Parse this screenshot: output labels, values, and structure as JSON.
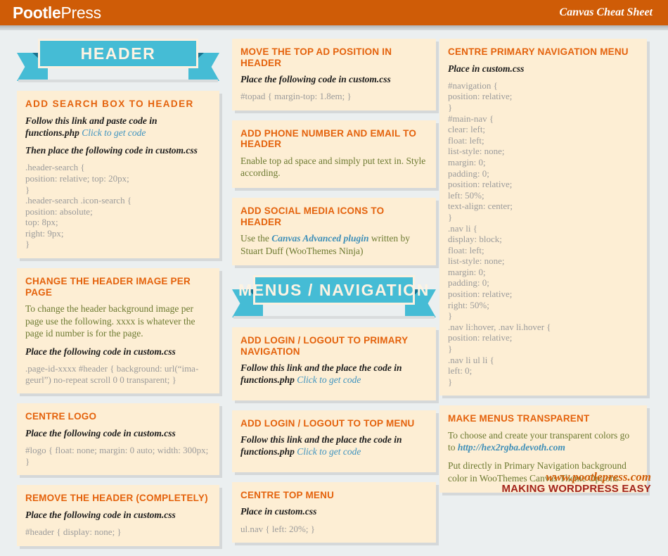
{
  "topbar": {
    "logo_bold": "Pootle",
    "logo_regular": "Press",
    "sheet_title": "Canvas Cheat Sheet",
    "background_color": "#cf5c07"
  },
  "colors": {
    "page_background": "#ebeff0",
    "card_background": "#fdeed4",
    "card_shadow": "#d5d8d9",
    "accent_orange": "#e4620c",
    "ribbon_teal": "#45bcd5",
    "ribbon_fold": "#17728f",
    "ribbon_border": "#fbf0e0",
    "code_grey": "#9b9b9b",
    "body_olive": "#6d7a31",
    "link_blue": "#3e93bf",
    "footer_url": "#cf5c07",
    "footer_tag": "#a3231a"
  },
  "banners": {
    "header": "HEADER",
    "menus": "MENUS / NAVIGATION"
  },
  "left_column": [
    {
      "title": "ADD  SEARCH BOX  TO HEADER",
      "lead": "Follow this link and paste code in functions.php ",
      "lead_link": "Click to get code",
      "lead2": "Then place the following code in custom.css",
      "code": ".header-search {\nposition: relative; top: 20px;\n}\n.header-search .icon-search {\nposition: absolute;\ntop: 8px;\nright: 9px;\n}"
    },
    {
      "title": "CHANGE THE HEADER IMAGE PER PAGE",
      "body": "To change the header background image per page use the following. xxxx is whatever the page id number is for the page.",
      "lead2": "Place the following code in custom.css",
      "code": ".page-id-xxxx #header { background: url(“ima-geurl”) no-repeat scroll 0 0 transparent; }"
    },
    {
      "title": "CENTRE LOGO",
      "lead2": "Place the following code in custom.css",
      "code": "#logo { float: none; margin: 0 auto; width: 300px; }"
    },
    {
      "title": "REMOVE THE HEADER (COMPLETELY)",
      "lead2": "Place the following code in custom.css",
      "code": "#header { display: none; }"
    }
  ],
  "mid_column_top": [
    {
      "title": "MOVE THE TOP AD POSITION IN HEADER",
      "lead2": "Place the following code in custom.css",
      "code": "#topad { margin-top: 1.8em; }"
    },
    {
      "title": "ADD PHONE NUMBER AND EMAIL TO HEADER",
      "body": "Enable top ad space and simply put text in. Style according."
    },
    {
      "title": "ADD SOCIAL MEDIA ICONS TO HEADER",
      "body_prefix": "Use the ",
      "body_emph": "Canvas Advanced plugin",
      "body_suffix": " written by Stuart Duff (WooThemes Ninja)"
    }
  ],
  "mid_column_bottom": [
    {
      "title": "ADD LOGIN / LOGOUT TO PRIMARY NAVIGATION",
      "lead": "Follow this link and the place the code in functions.php ",
      "lead_link": "Click to get code"
    },
    {
      "title": "ADD LOGIN / LOGOUT TO TOP MENU",
      "lead": "Follow this link and the place the code in functions.php ",
      "lead_link": "Click to get code"
    },
    {
      "title": "CENTRE TOP MENU",
      "lead2": "Place in custom.css",
      "code": "ul.nav { left: 20%; }"
    }
  ],
  "right_column": [
    {
      "title": "CENTRE PRIMARY NAVIGATION MENU",
      "lead2": "Place in custom.css",
      "code": "#navigation {\nposition: relative;\n}\n#main-nav {\nclear: left;\nfloat: left;\nlist-style: none;\nmargin: 0;\npadding: 0;\nposition: relative;\nleft: 50%;\ntext-align: center;\n}\n.nav li {\ndisplay: block;\nfloat: left;\nlist-style: none;\nmargin: 0;\npadding: 0;\nposition: relative;\nright: 50%;\n}\n.nav li:hover, .nav li.hover {\nposition: relative;\n}\n.nav li ul li {\nleft: 0;\n}"
    },
    {
      "title": "MAKE MENUS TRANSPARENT",
      "body": "To choose and create your transparent colors go to ",
      "body_link": "http://hex2rgba.devoth.com",
      "body2": "Put directly in Primary Navigation background color in WooThemes Canvas Theme Options"
    }
  ],
  "footer": {
    "url": "www.pootlepress.com",
    "tagline": "MAKING WORDPRESS EASY"
  }
}
